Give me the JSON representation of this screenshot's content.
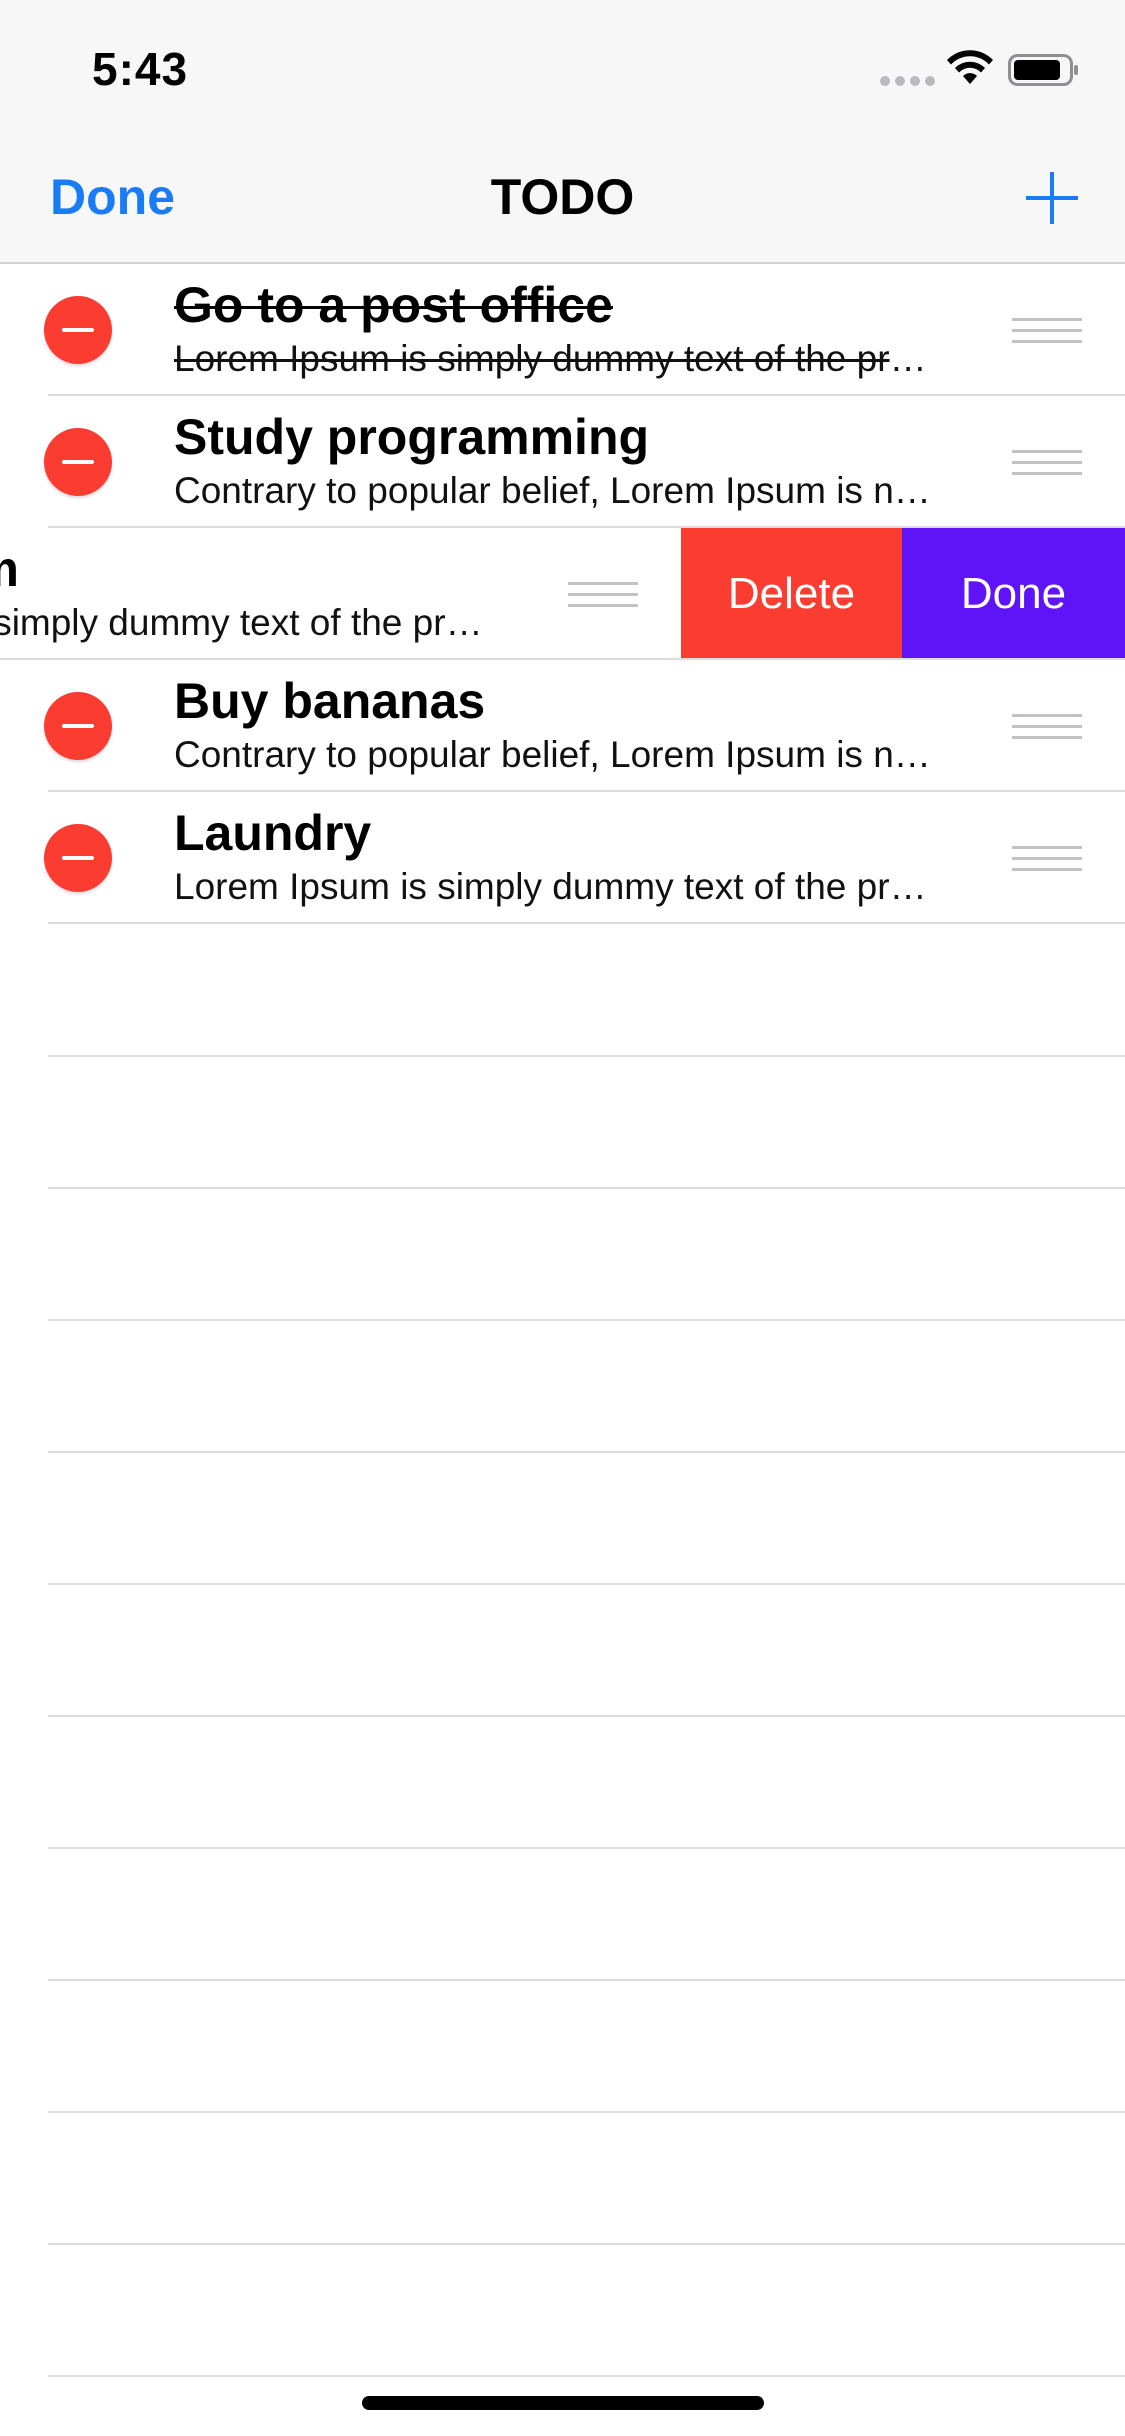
{
  "status_bar": {
    "time": "5:43"
  },
  "nav": {
    "done_label": "Done",
    "title": "TODO",
    "add_icon": "plus-icon"
  },
  "colors": {
    "accent": "#1a7cf5",
    "destructive": "#fb3c30",
    "done_action": "#5e14f6",
    "separator": "#dcdce0"
  },
  "list": {
    "items": [
      {
        "title": "Go to a post office",
        "subtitle": "Lorem Ipsum is simply dummy text of the pri…",
        "completed": true
      },
      {
        "title": "Study programming",
        "subtitle": "Contrary to popular belief, Lorem Ipsum is no…",
        "completed": false
      },
      {
        "title": "Go to a gym",
        "subtitle": "Lorem Ipsum is simply dummy text of the pri…",
        "completed": false,
        "swiped": true
      },
      {
        "title": "Buy bananas",
        "subtitle": "Contrary to popular belief, Lorem Ipsum is no…",
        "completed": false
      },
      {
        "title": "Laundry",
        "subtitle": "Lorem Ipsum is simply dummy text of the pri…",
        "completed": false
      }
    ],
    "swipe_actions": {
      "delete_label": "Delete",
      "done_label": "Done"
    }
  }
}
